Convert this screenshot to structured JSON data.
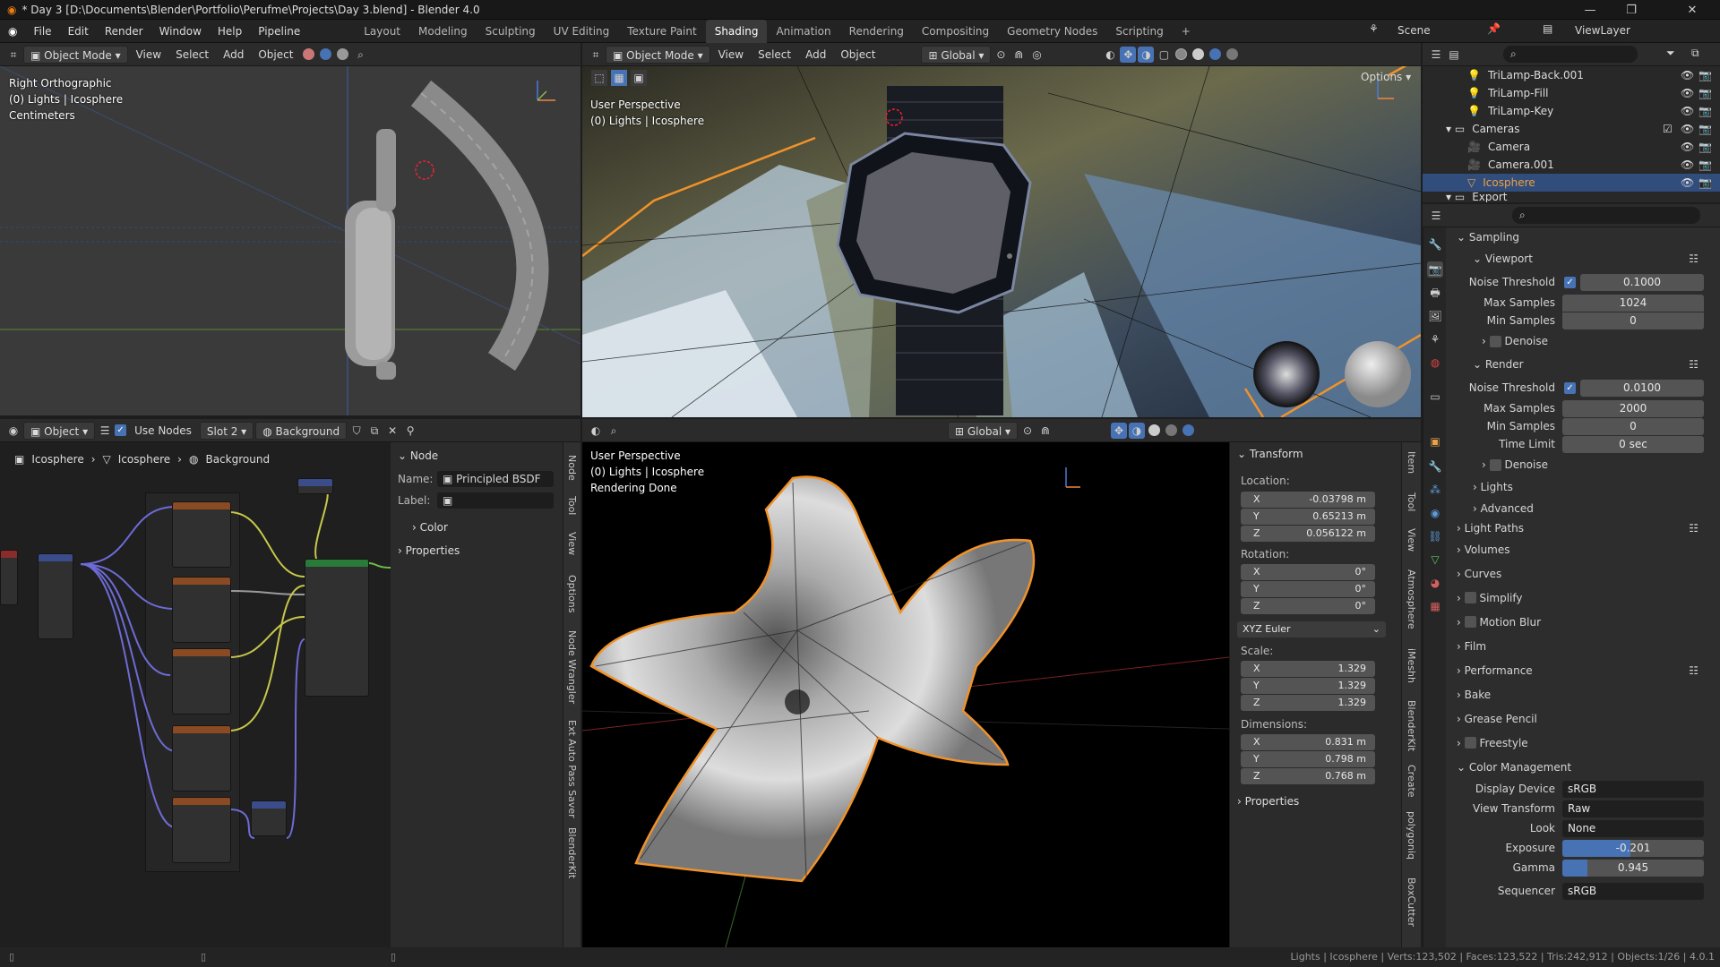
{
  "title_bar": {
    "title": "* Day 3 [D:\\Documents\\Blender\\Portfolio\\Perufme\\Projects\\Day 3.blend] - Blender 4.0"
  },
  "menu": [
    "File",
    "Edit",
    "Render",
    "Window",
    "Help",
    "Pipeline"
  ],
  "workspaces": [
    "Layout",
    "Modeling",
    "Sculpting",
    "UV Editing",
    "Texture Paint",
    "Shading",
    "Animation",
    "Rendering",
    "Compositing",
    "Geometry Nodes",
    "Scripting"
  ],
  "active_workspace": "Shading",
  "scene": {
    "scene_label": "Scene",
    "view_layer": "ViewLayer"
  },
  "viewport_left": {
    "mode": "Object Mode",
    "menus": [
      "View",
      "Select",
      "Add",
      "Object"
    ],
    "overlay": [
      "Right Orthographic",
      "(0) Lights | Icosphere",
      "Centimeters"
    ]
  },
  "viewport_top": {
    "mode": "Object Mode",
    "menus": [
      "View",
      "Select",
      "Add",
      "Object"
    ],
    "orientation": "Global",
    "options_label": "Options",
    "overlay": [
      "User Perspective",
      "(0) Lights | Icosphere"
    ]
  },
  "node_editor": {
    "object_mode": "Object",
    "use_nodes": "Use Nodes",
    "slot": "Slot 2",
    "world": "Background",
    "breadcrumb": [
      "Icosphere",
      "Icosphere",
      "Background"
    ]
  },
  "node_panel": {
    "section": "Node",
    "name_label": "Name:",
    "name_value": "Principled BSDF",
    "label_label": "Label:",
    "color": "Color",
    "properties": "Properties"
  },
  "node_tabs": [
    "Node",
    "Tool",
    "View",
    "Options",
    "Node Wrangler",
    "Ext Auto Pass Saver",
    "BlenderKit"
  ],
  "viewport_bottom": {
    "orientation": "Global",
    "overlay": [
      "User Perspective",
      "(0) Lights | Icosphere",
      "Rendering Done"
    ]
  },
  "transform": {
    "title": "Transform",
    "location_label": "Location:",
    "location": [
      {
        "axis": "X",
        "value": "-0.03798 m"
      },
      {
        "axis": "Y",
        "value": "0.65213 m"
      },
      {
        "axis": "Z",
        "value": "0.056122 m"
      }
    ],
    "rotation_label": "Rotation:",
    "rotation": [
      {
        "axis": "X",
        "value": "0°"
      },
      {
        "axis": "Y",
        "value": "0°"
      },
      {
        "axis": "Z",
        "value": "0°"
      }
    ],
    "rotation_mode": "XYZ Euler",
    "scale_label": "Scale:",
    "scale": [
      {
        "axis": "X",
        "value": "1.329"
      },
      {
        "axis": "Y",
        "value": "1.329"
      },
      {
        "axis": "Z",
        "value": "1.329"
      }
    ],
    "dimensions_label": "Dimensions:",
    "dimensions": [
      {
        "axis": "X",
        "value": "0.831 m"
      },
      {
        "axis": "Y",
        "value": "0.798 m"
      },
      {
        "axis": "Z",
        "value": "0.768 m"
      }
    ],
    "properties": "Properties"
  },
  "n_tabs": [
    "Item",
    "Tool",
    "View",
    "Atmosphere",
    "iMeshh",
    "BlenderKit",
    "Create",
    "polygoniq",
    "BoxCutter"
  ],
  "outliner": [
    {
      "name": "TriLamp-Back.001",
      "type": "light"
    },
    {
      "name": "TriLamp-Fill",
      "type": "light"
    },
    {
      "name": "TriLamp-Key",
      "type": "light"
    },
    {
      "name": "Cameras",
      "type": "collection"
    },
    {
      "name": "Camera",
      "type": "camera"
    },
    {
      "name": "Camera.001",
      "type": "camera"
    },
    {
      "name": "Icosphere",
      "type": "mesh"
    },
    {
      "name": "Export",
      "type": "collection"
    }
  ],
  "render_props": {
    "sampling": "Sampling",
    "viewport": "Viewport",
    "vp_noise_label": "Noise Threshold",
    "vp_noise": "0.1000",
    "vp_max_label": "Max Samples",
    "vp_max": "1024",
    "vp_min_label": "Min Samples",
    "vp_min": "0",
    "denoise": "Denoise",
    "render": "Render",
    "r_noise_label": "Noise Threshold",
    "r_noise": "0.0100",
    "r_max_label": "Max Samples",
    "r_max": "2000",
    "r_min_label": "Min Samples",
    "r_min": "0",
    "time_label": "Time Limit",
    "time": "0 sec",
    "denoise2": "Denoise",
    "lights": "Lights",
    "advanced": "Advanced",
    "light_paths": "Light Paths",
    "volumes": "Volumes",
    "curves": "Curves",
    "simplify": "Simplify",
    "motion_blur": "Motion Blur",
    "film": "Film",
    "performance": "Performance",
    "bake": "Bake",
    "grease_pencil": "Grease Pencil",
    "freestyle": "Freestyle",
    "color_management": "Color Management",
    "display_device_label": "Display Device",
    "display_device": "sRGB",
    "view_transform_label": "View Transform",
    "view_transform": "Raw",
    "look_label": "Look",
    "look": "None",
    "exposure_label": "Exposure",
    "exposure": "-0.201",
    "exposure_fill": 0.48,
    "gamma_label": "Gamma",
    "gamma": "0.945",
    "gamma_fill": 0.18,
    "sequencer_label": "Sequencer",
    "sequencer": "sRGB"
  },
  "status": "Lights | Icosphere | Verts:123,502 | Faces:123,522 | Tris:242,912 | Objects:1/26 | 4.0.1",
  "colors": {
    "accent": "#4772b3",
    "selection": "#e08a28",
    "active_row": "#304d7c"
  }
}
